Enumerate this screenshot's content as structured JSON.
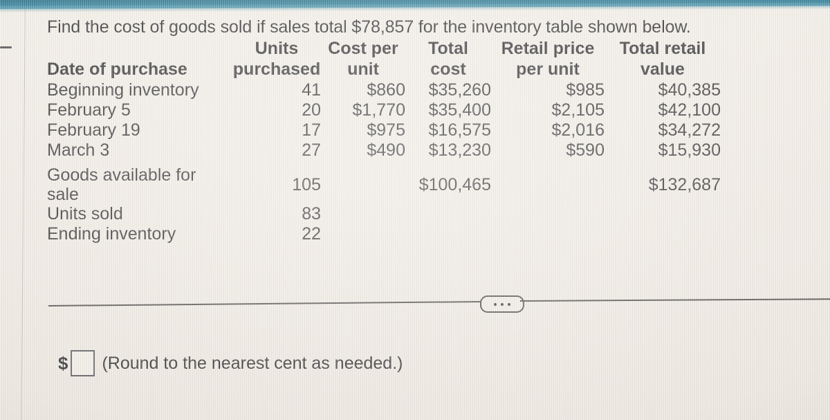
{
  "question": {
    "text": "Find the cost of goods sold if sales total $78,857 for the inventory table shown below.",
    "sales_total": "$78,857"
  },
  "table": {
    "headers": {
      "date_line1": "",
      "date_line2": "Date of purchase",
      "units_line1": "Units",
      "units_line2": "purchased",
      "cost_line1": "Cost per",
      "cost_line2": "unit",
      "total_line1": "Total",
      "total_line2": "cost",
      "retail_line1": "Retail price",
      "retail_line2": "per unit",
      "trv_line1": "Total retail",
      "trv_line2": "value"
    },
    "rows": [
      {
        "date": "Beginning inventory",
        "units": "41",
        "cost_per_unit": "$860",
        "total_cost": "$35,260",
        "retail_per_unit": "$985",
        "total_retail_value": "$40,385"
      },
      {
        "date": "February 5",
        "units": "20",
        "cost_per_unit": "$1,770",
        "total_cost": "$35,400",
        "retail_per_unit": "$2,105",
        "total_retail_value": "$42,100"
      },
      {
        "date": "February 19",
        "units": "17",
        "cost_per_unit": "$975",
        "total_cost": "$16,575",
        "retail_per_unit": "$2,016",
        "total_retail_value": "$34,272"
      },
      {
        "date": "March 3",
        "units": "27",
        "cost_per_unit": "$490",
        "total_cost": "$13,230",
        "retail_per_unit": "$590",
        "total_retail_value": "$15,930"
      }
    ],
    "summary": [
      {
        "date": "Goods available for sale",
        "units": "105",
        "cost_per_unit": "",
        "total_cost": "$100,465",
        "retail_per_unit": "",
        "total_retail_value": "$132,687"
      },
      {
        "date": "Units sold",
        "units": "83",
        "cost_per_unit": "",
        "total_cost": "",
        "retail_per_unit": "",
        "total_retail_value": ""
      },
      {
        "date": "Ending inventory",
        "units": "22",
        "cost_per_unit": "",
        "total_cost": "",
        "retail_per_unit": "",
        "total_retail_value": ""
      }
    ]
  },
  "divider": {
    "ellipsis_label": "..."
  },
  "answer": {
    "currency_symbol": "$",
    "input_value": "",
    "input_placeholder": "",
    "hint": "(Round to the nearest cent as needed.)"
  },
  "colors": {
    "page_background": "#efeae2",
    "text": "#1d1d20",
    "browser_chrome_teal": "#1a7390",
    "rule": "#3d3b38"
  }
}
